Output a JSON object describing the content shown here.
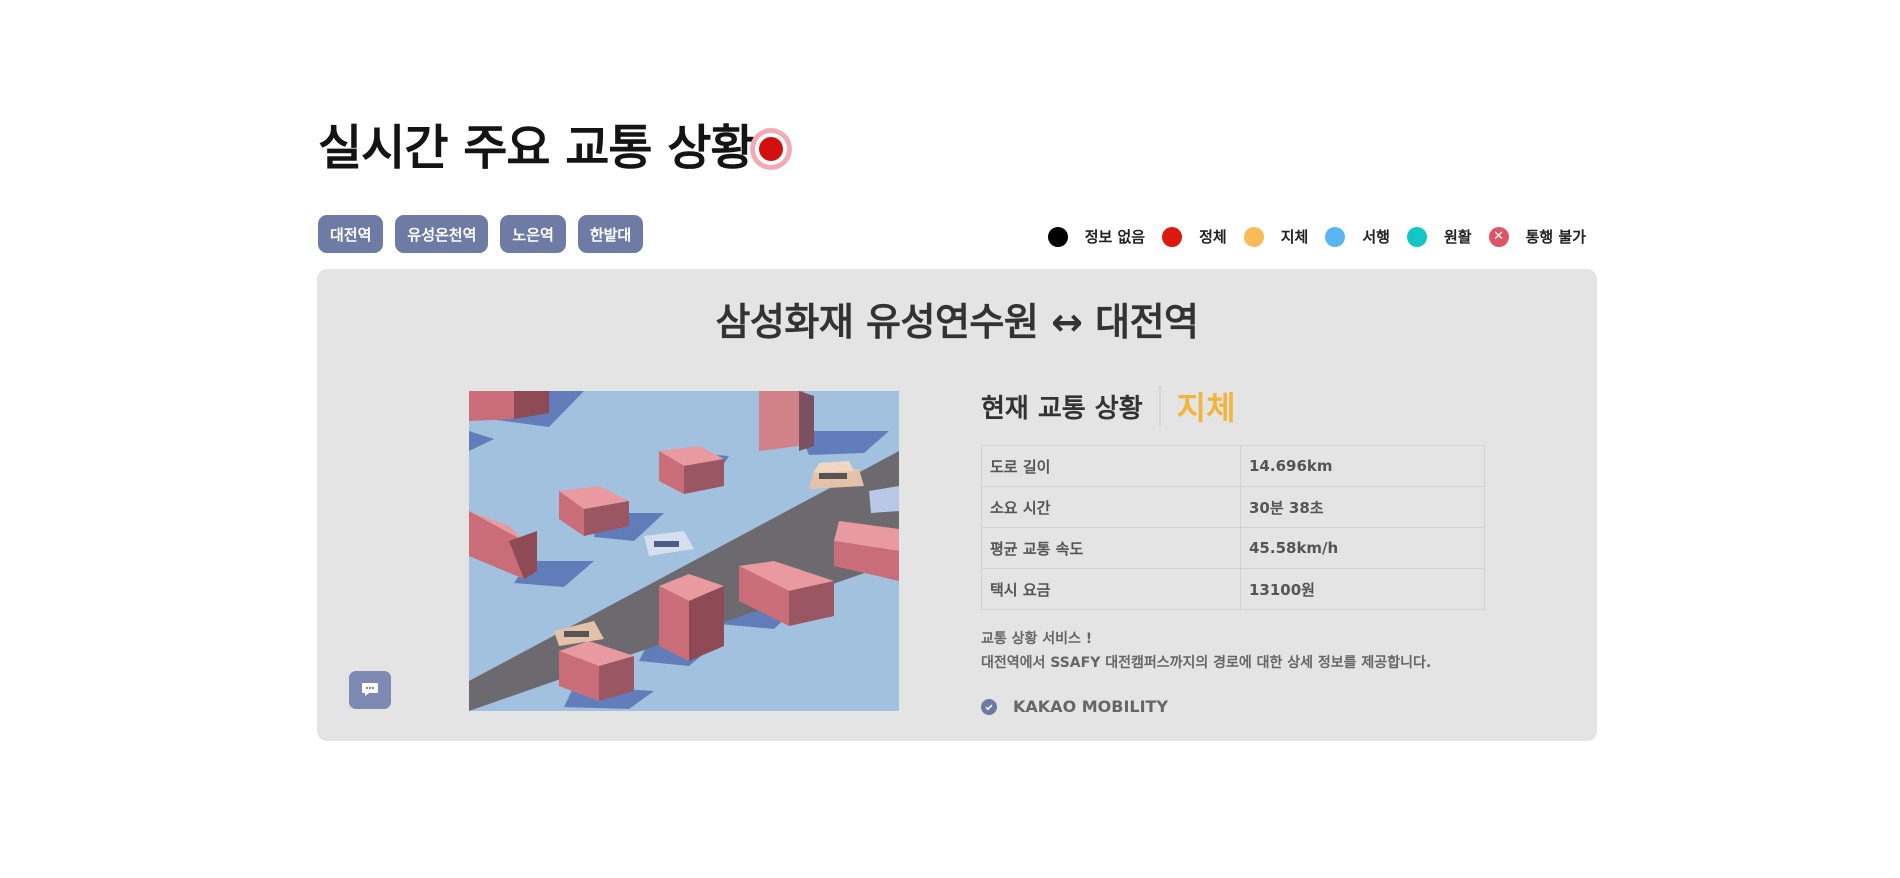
{
  "page": {
    "title": "실시간 주요 교통 상황"
  },
  "stations": [
    {
      "label": "대전역"
    },
    {
      "label": "유성온천역"
    },
    {
      "label": "노은역"
    },
    {
      "label": "한밭대"
    }
  ],
  "legend": [
    {
      "label": "정보 없음",
      "color": "#000000"
    },
    {
      "label": "정체",
      "color": "#d91a0e"
    },
    {
      "label": "지체",
      "color": "#f8bc57"
    },
    {
      "label": "서행",
      "color": "#5bb5f2"
    },
    {
      "label": "원활",
      "color": "#12c6c6"
    },
    {
      "label": "통행 불가",
      "color": "#e05467",
      "icon": "close-icon"
    }
  ],
  "route": {
    "title": "삼성화재 유성연수원 ↔ 대전역",
    "status_label": "현재 교통 상황",
    "status_value": "지체",
    "status_color": "#f2b53c",
    "details": [
      {
        "key": "도로 길이",
        "value": "14.696km"
      },
      {
        "key": "소요 시간",
        "value": "30분 38초"
      },
      {
        "key": "평균 교통 속도",
        "value": "45.58km/h"
      },
      {
        "key": "택시 요금",
        "value": "13100원"
      }
    ],
    "description": [
      "교통 상황 서비스 !",
      "대전역에서 SSAFY 대전캠퍼스까지의 경로에 대한 상세 정보를 제공합니다."
    ],
    "provider": "KAKAO MOBILITY"
  },
  "icons": {
    "live": "live-record-icon",
    "chat": "chat-bubble-icon",
    "check": "check-circle-icon"
  },
  "colors": {
    "accent": "#6e7ba5",
    "card_bg": "#e4e4e4",
    "live_red": "#d40f0f"
  }
}
